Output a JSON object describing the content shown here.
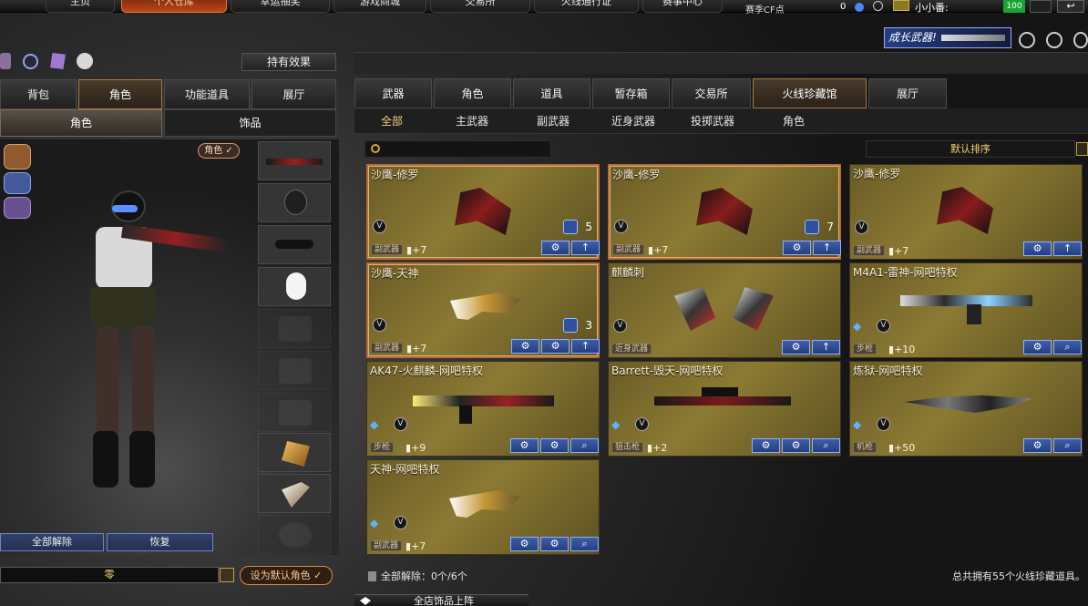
{
  "top_nav": {
    "items": [
      "主页",
      "个人仓库",
      "幸运抽奖",
      "游戏商城",
      "交易所",
      "火线通行证",
      "赛事中心"
    ],
    "season_label": "赛季CF点",
    "season_value": "0",
    "user_name": "小小番:",
    "level": "100"
  },
  "toolbar": {
    "growth_weapon": "成长武器!",
    "effect_button": "持有效果"
  },
  "left_panel": {
    "tabs": [
      "背包",
      "角色",
      "功能道具",
      "展厅"
    ],
    "subtabs": [
      "角色",
      "饰品"
    ],
    "role_badge": "角色",
    "footer_buttons": [
      "全部解除",
      "恢复"
    ],
    "name_value": "零",
    "default_role_button": "设为默认角色"
  },
  "main_panel": {
    "tabs": [
      "武器",
      "角色",
      "道具",
      "暂存箱",
      "交易所",
      "火线珍藏馆",
      "展厅"
    ],
    "active_tab": "火线珍藏馆",
    "subtabs": [
      "全部",
      "主武器",
      "副武器",
      "近身武器",
      "投掷武器",
      "角色"
    ],
    "search_placeholder": "",
    "sort_label": "默认排序",
    "footer_left": "全部解除：0个/6个",
    "footer_right": "总共拥有55个火线珍藏道具。",
    "bottom_panel_label": "全店饰品上阵"
  },
  "items": [
    {
      "name": "沙鹰-修罗",
      "type": "副武器",
      "level": "+7",
      "count": "5"
    },
    {
      "name": "沙鹰-修罗",
      "type": "副武器",
      "level": "+7",
      "count": "7"
    },
    {
      "name": "沙鹰-修罗",
      "type": "副武器",
      "level": "+7"
    },
    {
      "name": "沙鹰-天神",
      "type": "副武器",
      "level": "+7",
      "count": "3"
    },
    {
      "name": "麒麟刺",
      "type": "近身武器"
    },
    {
      "name": "M4A1-雷神-网吧特权",
      "type": "步枪",
      "level": "+10"
    },
    {
      "name": "AK47-火麒麟-网吧特权",
      "type": "步枪",
      "level": "+9"
    },
    {
      "name": "Barrett-毁天-网吧特权",
      "type": "狙击枪",
      "level": "+2"
    },
    {
      "name": "炼狱-网吧特权",
      "type": "机枪",
      "level": "+50"
    },
    {
      "name": "天神-网吧特权",
      "type": "副武器",
      "level": "+7"
    }
  ]
}
